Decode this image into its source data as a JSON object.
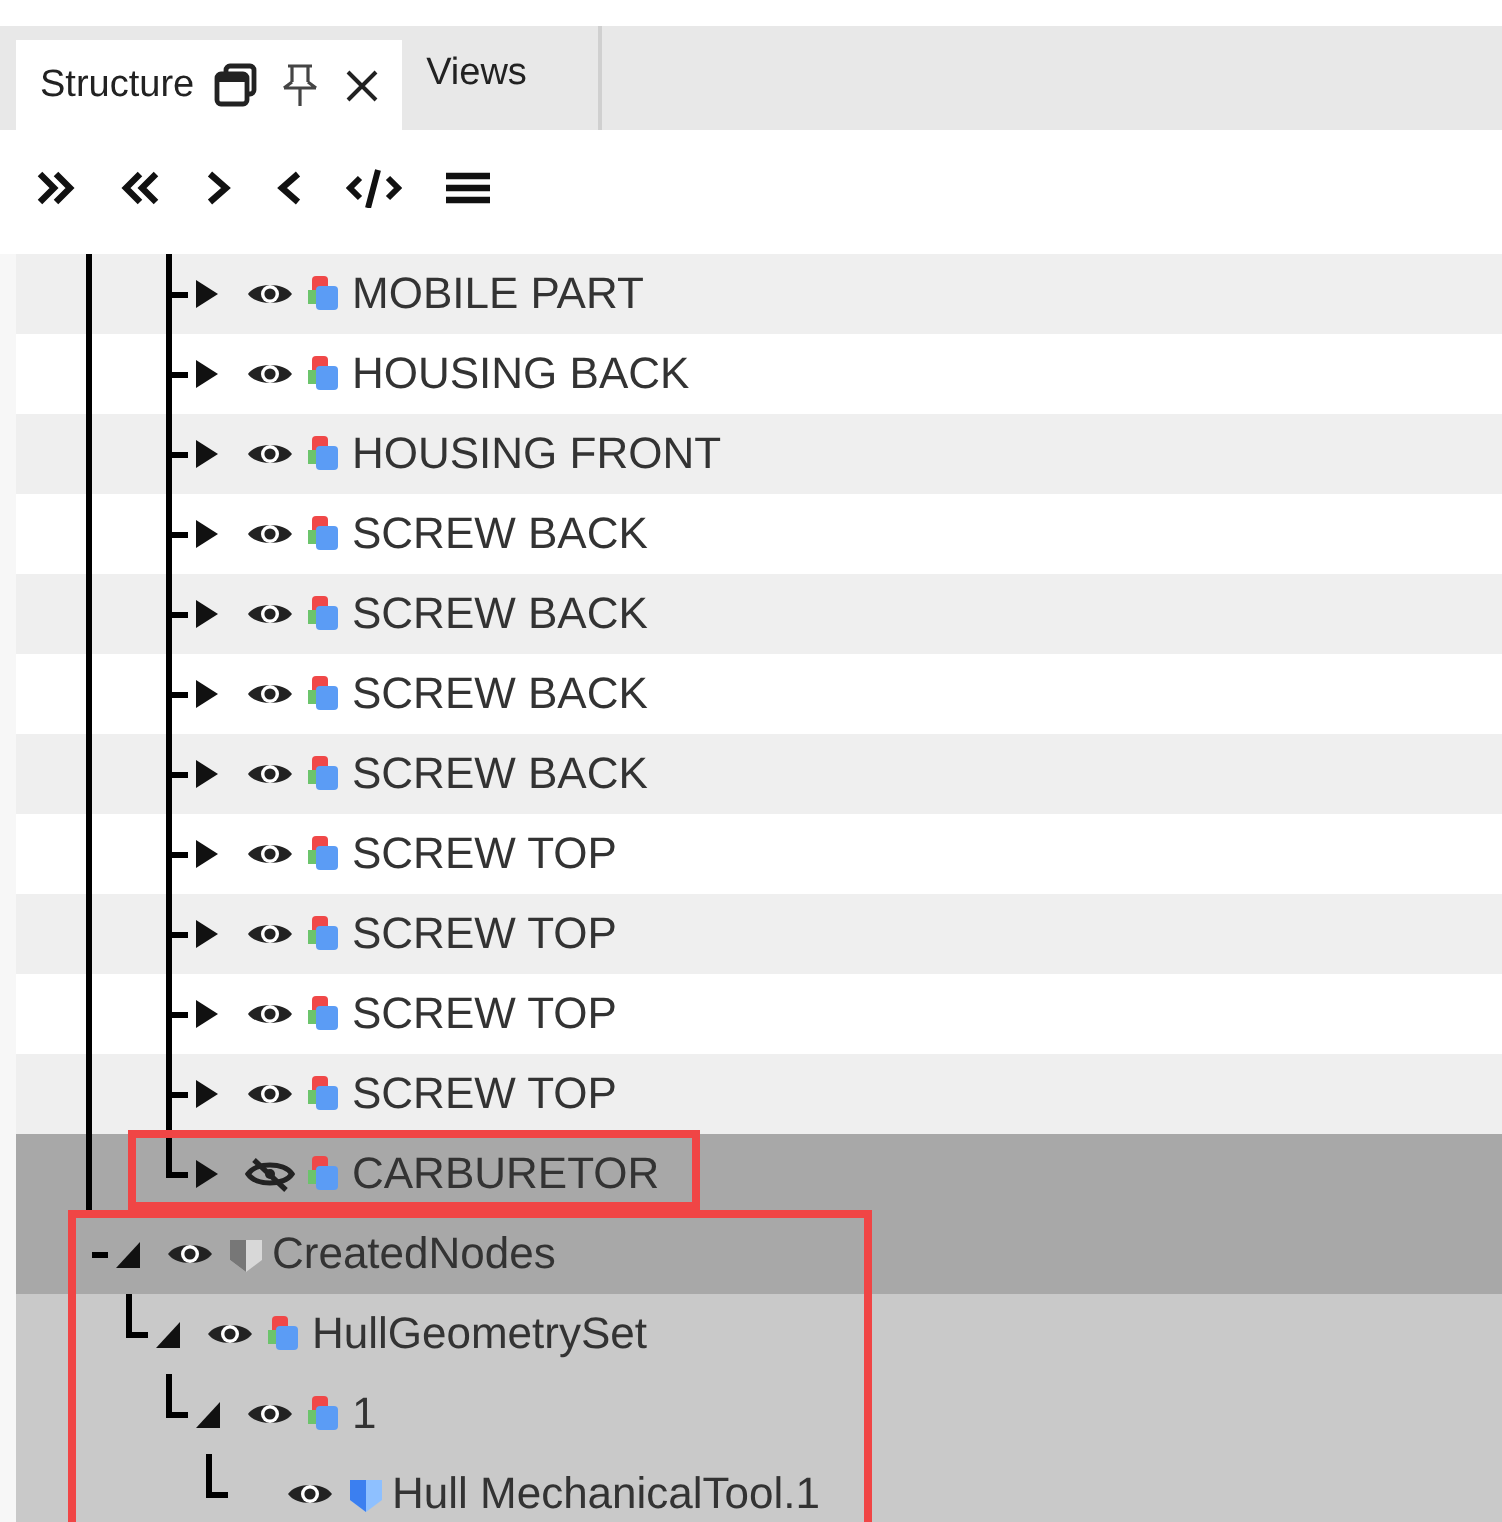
{
  "tabs": [
    {
      "label": "Structure",
      "selected": true
    },
    {
      "label": "Views",
      "selected": false
    }
  ],
  "toolbar": [
    {
      "kind": "expand_all"
    },
    {
      "kind": "collapse_all"
    },
    {
      "kind": "expand"
    },
    {
      "kind": "collapse"
    },
    {
      "kind": "code"
    },
    {
      "kind": "menu"
    }
  ],
  "tree": [
    {
      "children": [
        {
          "children": [
            {
              "label": "MOBILE PART",
              "kind": "part",
              "visible": true,
              "expanded": false,
              "selected": false,
              "highlighted": false
            },
            {
              "label": "HOUSING BACK",
              "kind": "part",
              "visible": true,
              "expanded": false,
              "selected": false,
              "highlighted": false
            },
            {
              "label": "HOUSING FRONT",
              "kind": "part",
              "visible": true,
              "expanded": false,
              "selected": false,
              "highlighted": false
            },
            {
              "label": "SCREW BACK",
              "kind": "part",
              "visible": true,
              "expanded": false,
              "selected": false,
              "highlighted": false
            },
            {
              "label": "SCREW BACK",
              "kind": "part",
              "visible": true,
              "expanded": false,
              "selected": false,
              "highlighted": false
            },
            {
              "label": "SCREW BACK",
              "kind": "part",
              "visible": true,
              "expanded": false,
              "selected": false,
              "highlighted": false
            },
            {
              "label": "SCREW BACK",
              "kind": "part",
              "visible": true,
              "expanded": false,
              "selected": false,
              "highlighted": false
            },
            {
              "label": "SCREW TOP",
              "kind": "part",
              "visible": true,
              "expanded": false,
              "selected": false,
              "highlighted": false
            },
            {
              "label": "SCREW TOP",
              "kind": "part",
              "visible": true,
              "expanded": false,
              "selected": false,
              "highlighted": false
            },
            {
              "label": "SCREW TOP",
              "kind": "part",
              "visible": true,
              "expanded": false,
              "selected": false,
              "highlighted": false
            },
            {
              "label": "SCREW TOP",
              "kind": "part",
              "visible": true,
              "expanded": false,
              "selected": false,
              "highlighted": false
            },
            {
              "label": "CARBURETOR",
              "kind": "part",
              "visible": false,
              "expanded": false,
              "selected": true,
              "highlighted": true
            }
          ]
        }
      ]
    },
    {
      "label": "CreatedNodes",
      "kind": "group",
      "visible": true,
      "expanded": true,
      "selected": true,
      "highlighted": true,
      "children": [
        {
          "label": "HullGeometrySet",
          "kind": "part",
          "visible": true,
          "expanded": true,
          "selected": false,
          "highlighted": false,
          "children": [
            {
              "label": "1",
              "kind": "part",
              "visible": true,
              "expanded": true,
              "selected": false,
              "highlighted": false,
              "children": [
                {
                  "label": "Hull MechanicalTool.1",
                  "kind": "body",
                  "visible": true,
                  "selected": false,
                  "highlighted": false
                }
              ]
            }
          ]
        }
      ]
    }
  ]
}
